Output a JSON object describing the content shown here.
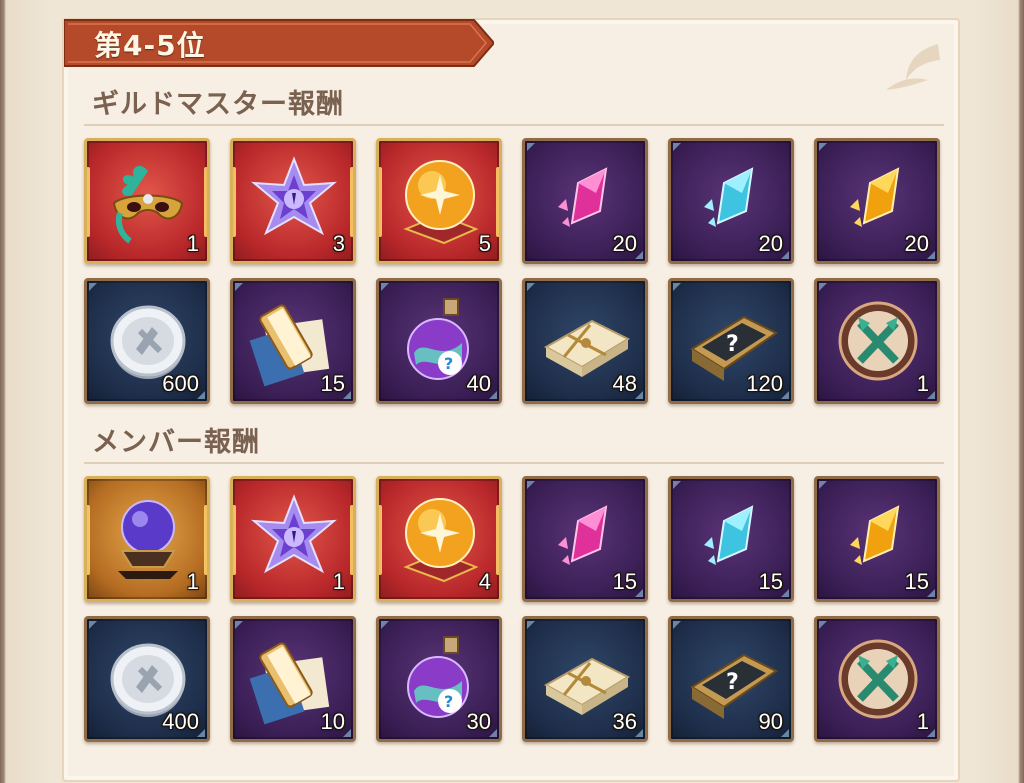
{
  "rank": {
    "title": "第4-5位"
  },
  "sections": [
    {
      "title": "ギルドマスター報酬",
      "items": [
        {
          "icon": "mask-icon",
          "frame": "red",
          "qty": "1",
          "glow": true
        },
        {
          "icon": "purple-star-gem-icon",
          "frame": "red",
          "qty": "3",
          "glow": true
        },
        {
          "icon": "orange-orb-icon",
          "frame": "red",
          "qty": "5",
          "glow": true
        },
        {
          "icon": "pink-crystal-icon",
          "frame": "purple",
          "qty": "20"
        },
        {
          "icon": "blue-crystal-icon",
          "frame": "purple",
          "qty": "20"
        },
        {
          "icon": "gold-crystal-icon",
          "frame": "purple",
          "qty": "20"
        },
        {
          "icon": "silver-coin-icon",
          "frame": "navy",
          "qty": "600"
        },
        {
          "icon": "scroll-book-icon",
          "frame": "purple",
          "qty": "15"
        },
        {
          "icon": "rainbow-potion-icon",
          "frame": "purple",
          "qty": "40"
        },
        {
          "icon": "paper-bundle-icon",
          "frame": "navy",
          "qty": "48"
        },
        {
          "icon": "mystery-book-icon",
          "frame": "navy",
          "qty": "120"
        },
        {
          "icon": "guild-emblem-icon",
          "frame": "purple",
          "qty": "1"
        }
      ]
    },
    {
      "title": "メンバー報酬",
      "items": [
        {
          "icon": "crystal-ball-icon",
          "frame": "gold",
          "qty": "1",
          "glow": true
        },
        {
          "icon": "purple-star-gem-icon",
          "frame": "red",
          "qty": "1",
          "glow": true
        },
        {
          "icon": "orange-orb-icon",
          "frame": "red",
          "qty": "4",
          "glow": true
        },
        {
          "icon": "pink-crystal-icon",
          "frame": "purple",
          "qty": "15"
        },
        {
          "icon": "blue-crystal-icon",
          "frame": "purple",
          "qty": "15"
        },
        {
          "icon": "gold-crystal-icon",
          "frame": "purple",
          "qty": "15"
        },
        {
          "icon": "silver-coin-icon",
          "frame": "navy",
          "qty": "400"
        },
        {
          "icon": "scroll-book-icon",
          "frame": "purple",
          "qty": "10"
        },
        {
          "icon": "rainbow-potion-icon",
          "frame": "purple",
          "qty": "30"
        },
        {
          "icon": "paper-bundle-icon",
          "frame": "navy",
          "qty": "36"
        },
        {
          "icon": "mystery-book-icon",
          "frame": "navy",
          "qty": "90"
        },
        {
          "icon": "guild-emblem-icon",
          "frame": "purple",
          "qty": "1"
        }
      ]
    }
  ],
  "colors": {
    "banner": "#b44a2a",
    "section_title": "#7a6150",
    "panel": "#f7efe3"
  }
}
